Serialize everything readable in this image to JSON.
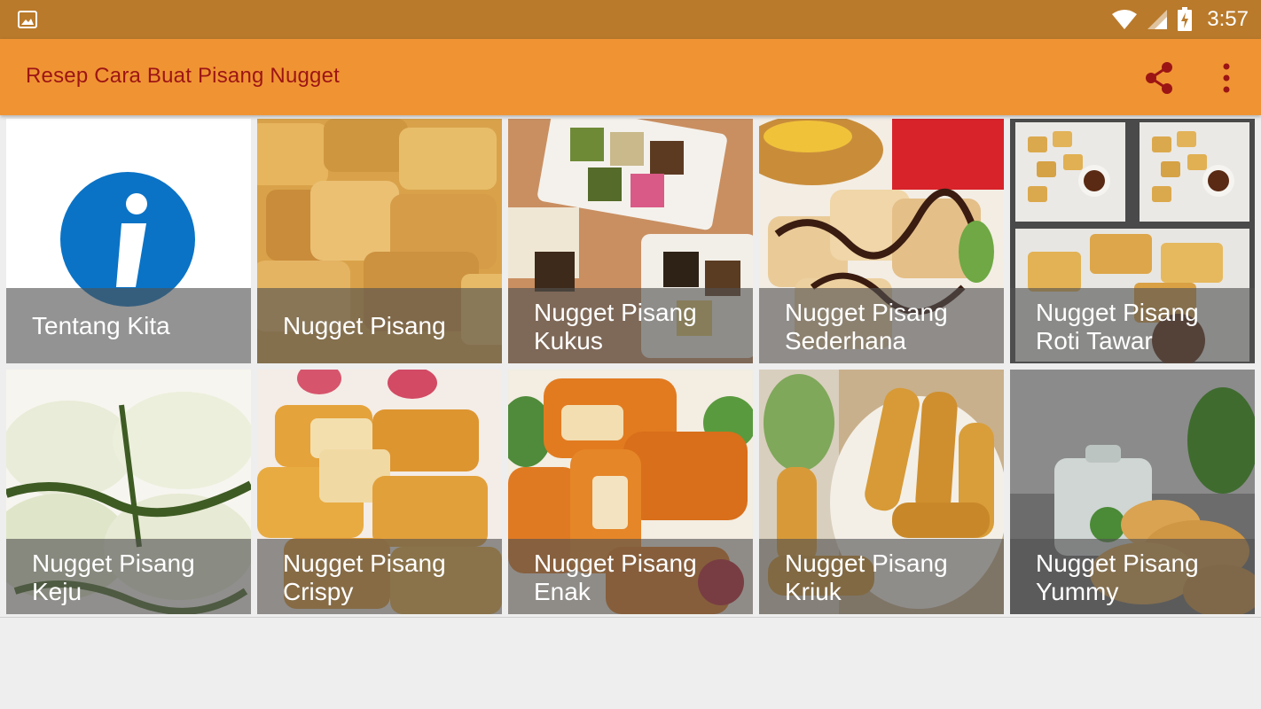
{
  "status_bar": {
    "time": "3:57",
    "icons": [
      "image-notification-icon",
      "wifi-icon",
      "cell-signal-icon",
      "battery-charging-icon"
    ]
  },
  "app_bar": {
    "title": "Resep Cara Buat Pisang Nugget",
    "actions": [
      "share-icon",
      "overflow-menu-icon"
    ],
    "title_color": "#9c1515",
    "background": "#f09433"
  },
  "tiles": [
    {
      "line1": "Tentang Kita",
      "line2": ""
    },
    {
      "line1": "Nugget Pisang",
      "line2": ""
    },
    {
      "line1": "Nugget Pisang",
      "line2": "Kukus"
    },
    {
      "line1": "Nugget Pisang",
      "line2": "Sederhana"
    },
    {
      "line1": "Nugget Pisang",
      "line2": "Roti Tawar"
    },
    {
      "line1": "Nugget Pisang",
      "line2": "Keju"
    },
    {
      "line1": "Nugget Pisang",
      "line2": "Crispy"
    },
    {
      "line1": "Nugget Pisang",
      "line2": "Enak"
    },
    {
      "line1": "Nugget Pisang",
      "line2": "Kriuk"
    },
    {
      "line1": "Nugget Pisang",
      "line2": "Yummy"
    }
  ]
}
